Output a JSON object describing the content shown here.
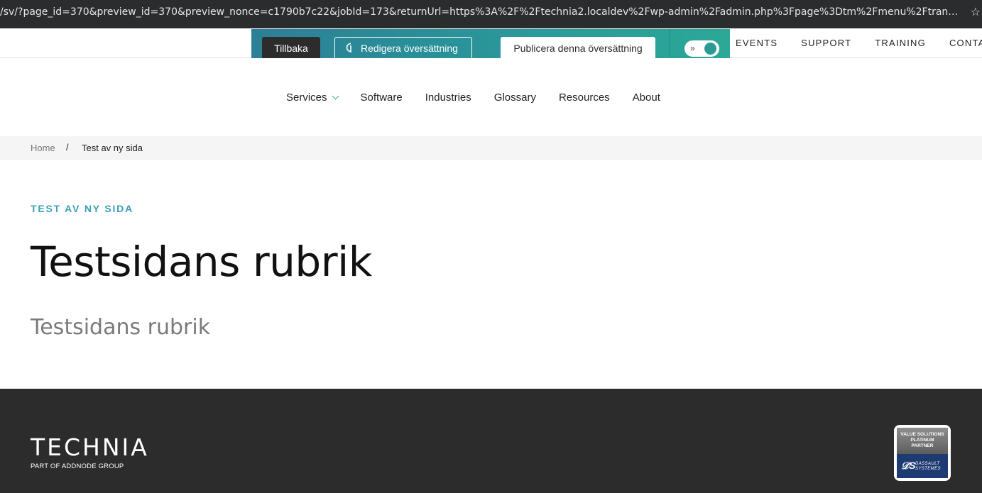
{
  "browser": {
    "url": "/sv/?page_id=370&preview_id=370&preview_nonce=c1790b7c22&jobId=173&returnUrl=https%3A%2F%2Ftechnia2.localdev%2Fwp-admin%2Fadmin.php%3Fpage%3Dtm%2Fmenu%2Ftranslations-que..."
  },
  "topnav": {
    "links": [
      "EVENTS",
      "SUPPORT",
      "TRAINING",
      "CONTAC"
    ]
  },
  "toolbar": {
    "back_label": "Tillbaka",
    "edit_label": "Redigera översättning",
    "publish_label": "Publicera denna översättning",
    "toggle_on": true
  },
  "mainnav": {
    "items": [
      "Services",
      "Software",
      "Industries",
      "Glossary",
      "Resources",
      "About"
    ]
  },
  "breadcrumb": {
    "home": "Home",
    "separator": "/",
    "current": "Test av ny sida"
  },
  "content": {
    "eyebrow": "TEST AV NY SIDA",
    "title": "Testsidans rubrik",
    "subtitle": "Testsidans rubrik"
  },
  "footer": {
    "logo_word": "TECHNIA",
    "logo_tag": "PART OF ADDNODE GROUP",
    "badge_line1": "VALUE SOLUTIONS",
    "badge_line2": "PLATINUM",
    "badge_line3": "PARTNER",
    "badge_brand1": "DASSAULT",
    "badge_brand2": "SYSTEMES"
  },
  "colors": {
    "accent": "#3aa0b6",
    "toolbar": "#2a9a9a",
    "footer": "#2c2c2c"
  }
}
